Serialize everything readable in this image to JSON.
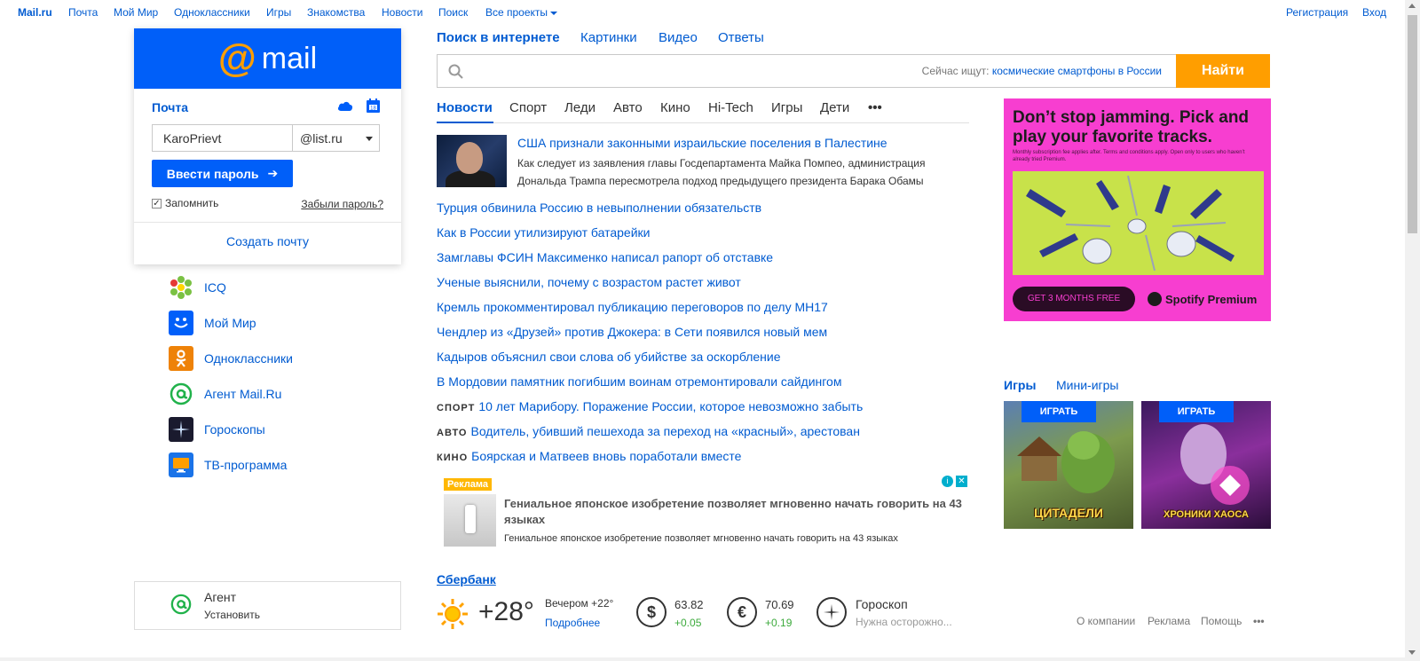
{
  "topnav": {
    "brand": "Mail.ru",
    "items": [
      "Почта",
      "Мой Мир",
      "Одноклассники",
      "Игры",
      "Знакомства",
      "Новости",
      "Поиск",
      "Все проекты"
    ],
    "register": "Регистрация",
    "login": "Вход"
  },
  "login": {
    "logo_word": "mail",
    "title": "Почта",
    "username_value": "KaroPrievt",
    "domain": "@list.ru",
    "enter_button": "Ввести пароль",
    "remember_label": "Запомнить",
    "remember_checked": true,
    "forgot": "Забыли пароль?",
    "create": "Создать почту"
  },
  "services": [
    {
      "label": "ICQ",
      "icon": "icq-icon",
      "color": "#ffffff"
    },
    {
      "label": "Мой Мир",
      "icon": "moy-mir-icon",
      "color": "#005ff9"
    },
    {
      "label": "Одноклассники",
      "icon": "odnoklassniki-icon",
      "color": "#ee8208"
    },
    {
      "label": "Агент Mail.Ru",
      "icon": "agent-icon",
      "color": "#ffffff"
    },
    {
      "label": "Гороскопы",
      "icon": "horoscope-icon",
      "color": "#1a1a2e"
    },
    {
      "label": "ТВ-программа",
      "icon": "tv-icon",
      "color": "#1a73e8"
    }
  ],
  "agent_box": {
    "title": "Агент",
    "action": "Установить"
  },
  "search": {
    "tabs": [
      "Поиск в интернете",
      "Картинки",
      "Видео",
      "Ответы"
    ],
    "hint_prefix": "Сейчас ищут:",
    "hint_query": "космические смартфоны в России",
    "button": "Найти"
  },
  "news_tabs": [
    "Новости",
    "Спорт",
    "Леди",
    "Авто",
    "Кино",
    "Hi-Tech",
    "Игры",
    "Дети",
    "•••"
  ],
  "news": {
    "lead": {
      "title": "США признали законными израильские поселения в Палестине",
      "text": "Как следует из заявления главы Госдепартамента Майка Помпео, администрация Дональда Трампа пересмотрела подход предыдущего президента Барака Обамы"
    },
    "items": [
      {
        "cat": "",
        "title": "Турция обвинила Россию в невыполнении обязательств"
      },
      {
        "cat": "",
        "title": "Как в России утилизируют батарейки"
      },
      {
        "cat": "",
        "title": "Замглавы ФСИН Максименко написал рапорт об отставке"
      },
      {
        "cat": "",
        "title": "Ученые выяснили, почему с возрастом растет живот"
      },
      {
        "cat": "",
        "title": "Кремль прокомментировал публикацию переговоров по делу MH17"
      },
      {
        "cat": "",
        "title": "Чендлер из «Друзей» против Джокера: в Сети появился новый мем"
      },
      {
        "cat": "",
        "title": "Кадыров объяснил свои слова об убийстве за оскорбление"
      },
      {
        "cat": "",
        "title": "В Мордовии памятник погибшим воинам отремонтировали сайдингом"
      },
      {
        "cat": "СПОРТ",
        "title": "10 лет Марибору. Поражение России, которое невозможно забыть"
      },
      {
        "cat": "АВТО",
        "title": "Водитель, убивший пешехода за переход на «красный», арестован"
      },
      {
        "cat": "КИНО",
        "title": "Боярская и Матвеев вновь поработали вместе"
      }
    ]
  },
  "ad": {
    "badge": "Реклама",
    "title": "Гениальное японское изобретение позволяет мгновенно начать говорить на 43 языках",
    "sub": "Гениальное японское изобретение позволяет мгновенно начать говорить на 43 языках"
  },
  "sber": "Сбербанк",
  "weather": {
    "temp": "+28°",
    "evening": "Вечером +22°",
    "more": "Подробнее"
  },
  "rates": [
    {
      "sym": "$",
      "value": "63.82",
      "delta": "+0.05"
    },
    {
      "sym": "€",
      "value": "70.69",
      "delta": "+0.19"
    }
  ],
  "horoscope": {
    "title": "Гороскоп",
    "text": "Нужна осторожно..."
  },
  "banner": {
    "headline": "Don’t stop jamming. Pick and play your favorite tracks.",
    "fine": "Monthly subscription fee applies after. Terms and conditions apply. Open only to users who haven’t already tried Premium.",
    "cta": "GET 3 MONTHS FREE",
    "brand": "Spotify Premium"
  },
  "games": {
    "tabs": [
      "Игры",
      "Мини-игры"
    ],
    "play_label": "ИГРАТЬ",
    "cards": [
      {
        "title": "ЦИТАДЕЛИ"
      },
      {
        "title": "ХРОНИКИ ХАОСА"
      }
    ]
  },
  "footer": [
    "О компании",
    "Реклама",
    "Помощь",
    "•••"
  ],
  "colors": {
    "accent": "#005ff9",
    "link": "#005bd1",
    "orange": "#ff9e00",
    "green": "#3caa3c"
  }
}
